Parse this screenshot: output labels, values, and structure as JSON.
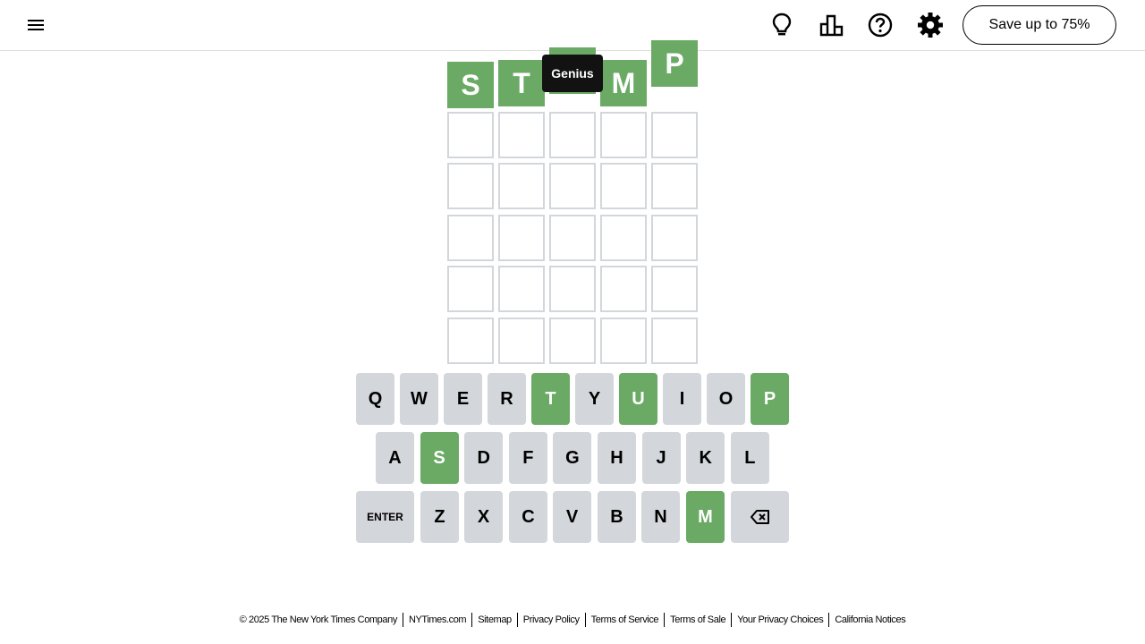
{
  "header": {
    "menu_icon": "hamburger-menu-icon",
    "hint_icon": "lightbulb-icon",
    "stats_icon": "bar-chart-icon",
    "help_icon": "question-circle-icon",
    "settings_icon": "gear-icon",
    "save_label": "Save up to 75%"
  },
  "toast": {
    "text": "Genius"
  },
  "colors": {
    "correct": "#6aaa64",
    "key": "#d3d6da",
    "border": "#d3d6da",
    "toast": "#121212"
  },
  "board": {
    "rows": [
      [
        {
          "letter": "S",
          "state": "correct"
        },
        {
          "letter": "T",
          "state": "correct"
        },
        {
          "letter": "",
          "state": "correct"
        },
        {
          "letter": "M",
          "state": "correct"
        },
        {
          "letter": "P",
          "state": "correct"
        }
      ],
      [
        {
          "letter": "",
          "state": "empty"
        },
        {
          "letter": "",
          "state": "empty"
        },
        {
          "letter": "",
          "state": "empty"
        },
        {
          "letter": "",
          "state": "empty"
        },
        {
          "letter": "",
          "state": "empty"
        }
      ],
      [
        {
          "letter": "",
          "state": "empty"
        },
        {
          "letter": "",
          "state": "empty"
        },
        {
          "letter": "",
          "state": "empty"
        },
        {
          "letter": "",
          "state": "empty"
        },
        {
          "letter": "",
          "state": "empty"
        }
      ],
      [
        {
          "letter": "",
          "state": "empty"
        },
        {
          "letter": "",
          "state": "empty"
        },
        {
          "letter": "",
          "state": "empty"
        },
        {
          "letter": "",
          "state": "empty"
        },
        {
          "letter": "",
          "state": "empty"
        }
      ],
      [
        {
          "letter": "",
          "state": "empty"
        },
        {
          "letter": "",
          "state": "empty"
        },
        {
          "letter": "",
          "state": "empty"
        },
        {
          "letter": "",
          "state": "empty"
        },
        {
          "letter": "",
          "state": "empty"
        }
      ],
      [
        {
          "letter": "",
          "state": "empty"
        },
        {
          "letter": "",
          "state": "empty"
        },
        {
          "letter": "",
          "state": "empty"
        },
        {
          "letter": "",
          "state": "empty"
        },
        {
          "letter": "",
          "state": "empty"
        }
      ]
    ]
  },
  "keyboard": {
    "row1": [
      {
        "label": "Q",
        "state": "default"
      },
      {
        "label": "W",
        "state": "default"
      },
      {
        "label": "E",
        "state": "default"
      },
      {
        "label": "R",
        "state": "default"
      },
      {
        "label": "T",
        "state": "correct"
      },
      {
        "label": "Y",
        "state": "default"
      },
      {
        "label": "U",
        "state": "correct"
      },
      {
        "label": "I",
        "state": "default"
      },
      {
        "label": "O",
        "state": "default"
      },
      {
        "label": "P",
        "state": "correct"
      }
    ],
    "row2": [
      {
        "label": "A",
        "state": "default"
      },
      {
        "label": "S",
        "state": "correct"
      },
      {
        "label": "D",
        "state": "default"
      },
      {
        "label": "F",
        "state": "default"
      },
      {
        "label": "G",
        "state": "default"
      },
      {
        "label": "H",
        "state": "default"
      },
      {
        "label": "J",
        "state": "default"
      },
      {
        "label": "K",
        "state": "default"
      },
      {
        "label": "L",
        "state": "default"
      }
    ],
    "row3": [
      {
        "label": "ENTER",
        "state": "default"
      },
      {
        "label": "Z",
        "state": "default"
      },
      {
        "label": "X",
        "state": "default"
      },
      {
        "label": "C",
        "state": "default"
      },
      {
        "label": "V",
        "state": "default"
      },
      {
        "label": "B",
        "state": "default"
      },
      {
        "label": "N",
        "state": "default"
      },
      {
        "label": "M",
        "state": "correct"
      },
      {
        "label": "",
        "state": "default",
        "icon": "backspace-icon"
      }
    ]
  },
  "footer": {
    "copyright": "© 2025 The New York Times Company",
    "links": [
      "NYTimes.com",
      "Sitemap",
      "Privacy Policy",
      "Terms of Service",
      "Terms of Sale",
      "Your Privacy Choices",
      "California Notices"
    ]
  }
}
